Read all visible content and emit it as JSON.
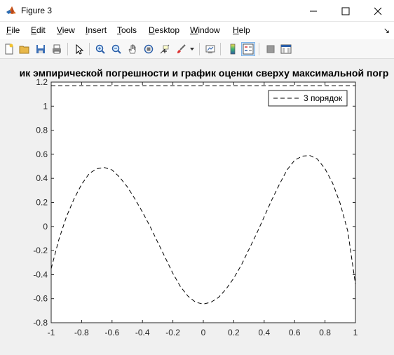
{
  "window": {
    "title": "Figure 3"
  },
  "menu": {
    "items": [
      {
        "key": "F",
        "rest": "ile"
      },
      {
        "key": "E",
        "rest": "dit"
      },
      {
        "key": "V",
        "rest": "iew"
      },
      {
        "key": "I",
        "rest": "nsert"
      },
      {
        "key": "T",
        "rest": "ools"
      },
      {
        "key": "D",
        "rest": "esktop"
      },
      {
        "key": "W",
        "rest": "indow"
      },
      {
        "key": "H",
        "rest": "elp"
      }
    ]
  },
  "toolbar": {
    "icons": [
      "new-figure-icon",
      "open-file-icon",
      "save-icon",
      "print-icon",
      "edit-plot-arrow-icon",
      "zoom-in-icon",
      "zoom-out-icon",
      "pan-hand-icon",
      "rotate-3d-icon",
      "data-cursor-icon",
      "brush-icon",
      "link-plot-icon",
      "colorbar-icon",
      "legend-icon",
      "hide-plot-tools-icon",
      "show-plot-tools-icon"
    ]
  },
  "chart_data": {
    "type": "line",
    "title": "ик эмпирической погрешности и график оценки сверху максимальной погр",
    "xlabel": "",
    "ylabel": "",
    "xlim": [
      -1,
      1
    ],
    "ylim": [
      -0.8,
      1.2
    ],
    "xticks": [
      "-1",
      "-0.8",
      "-0.6",
      "-0.4",
      "-0.2",
      "0",
      "0.2",
      "0.4",
      "0.6",
      "0.8",
      "1"
    ],
    "yticks": [
      "-0.8",
      "-0.6",
      "-0.4",
      "-0.2",
      "0",
      "0.2",
      "0.4",
      "0.6",
      "0.8",
      "1",
      "1.2"
    ],
    "grid": false,
    "legend_position": "top-right",
    "series": [
      {
        "name": "3 порядок",
        "style": "dashed",
        "color": "#000000",
        "x": [
          -1.0,
          -0.95,
          -0.9,
          -0.85,
          -0.8,
          -0.75,
          -0.7,
          -0.65,
          -0.6,
          -0.55,
          -0.5,
          -0.45,
          -0.4,
          -0.35,
          -0.3,
          -0.25,
          -0.2,
          -0.15,
          -0.1,
          -0.05,
          0.0,
          0.05,
          0.1,
          0.15,
          0.2,
          0.25,
          0.3,
          0.35,
          0.4,
          0.45,
          0.5,
          0.55,
          0.6,
          0.65,
          0.7,
          0.75,
          0.8,
          0.85,
          0.9,
          0.95,
          1.0
        ],
        "y": [
          -0.35,
          -0.11,
          0.08,
          0.23,
          0.35,
          0.44,
          0.48,
          0.49,
          0.47,
          0.41,
          0.33,
          0.23,
          0.12,
          0.0,
          -0.13,
          -0.26,
          -0.39,
          -0.5,
          -0.58,
          -0.63,
          -0.645,
          -0.63,
          -0.59,
          -0.52,
          -0.43,
          -0.32,
          -0.19,
          -0.06,
          0.08,
          0.22,
          0.35,
          0.47,
          0.55,
          0.585,
          0.59,
          0.56,
          0.48,
          0.36,
          0.19,
          -0.04,
          -0.48
        ]
      },
      {
        "name": "",
        "style": "dashed",
        "color": "#000000",
        "x": [
          -1,
          1
        ],
        "y": [
          1.17,
          1.17
        ]
      }
    ]
  }
}
